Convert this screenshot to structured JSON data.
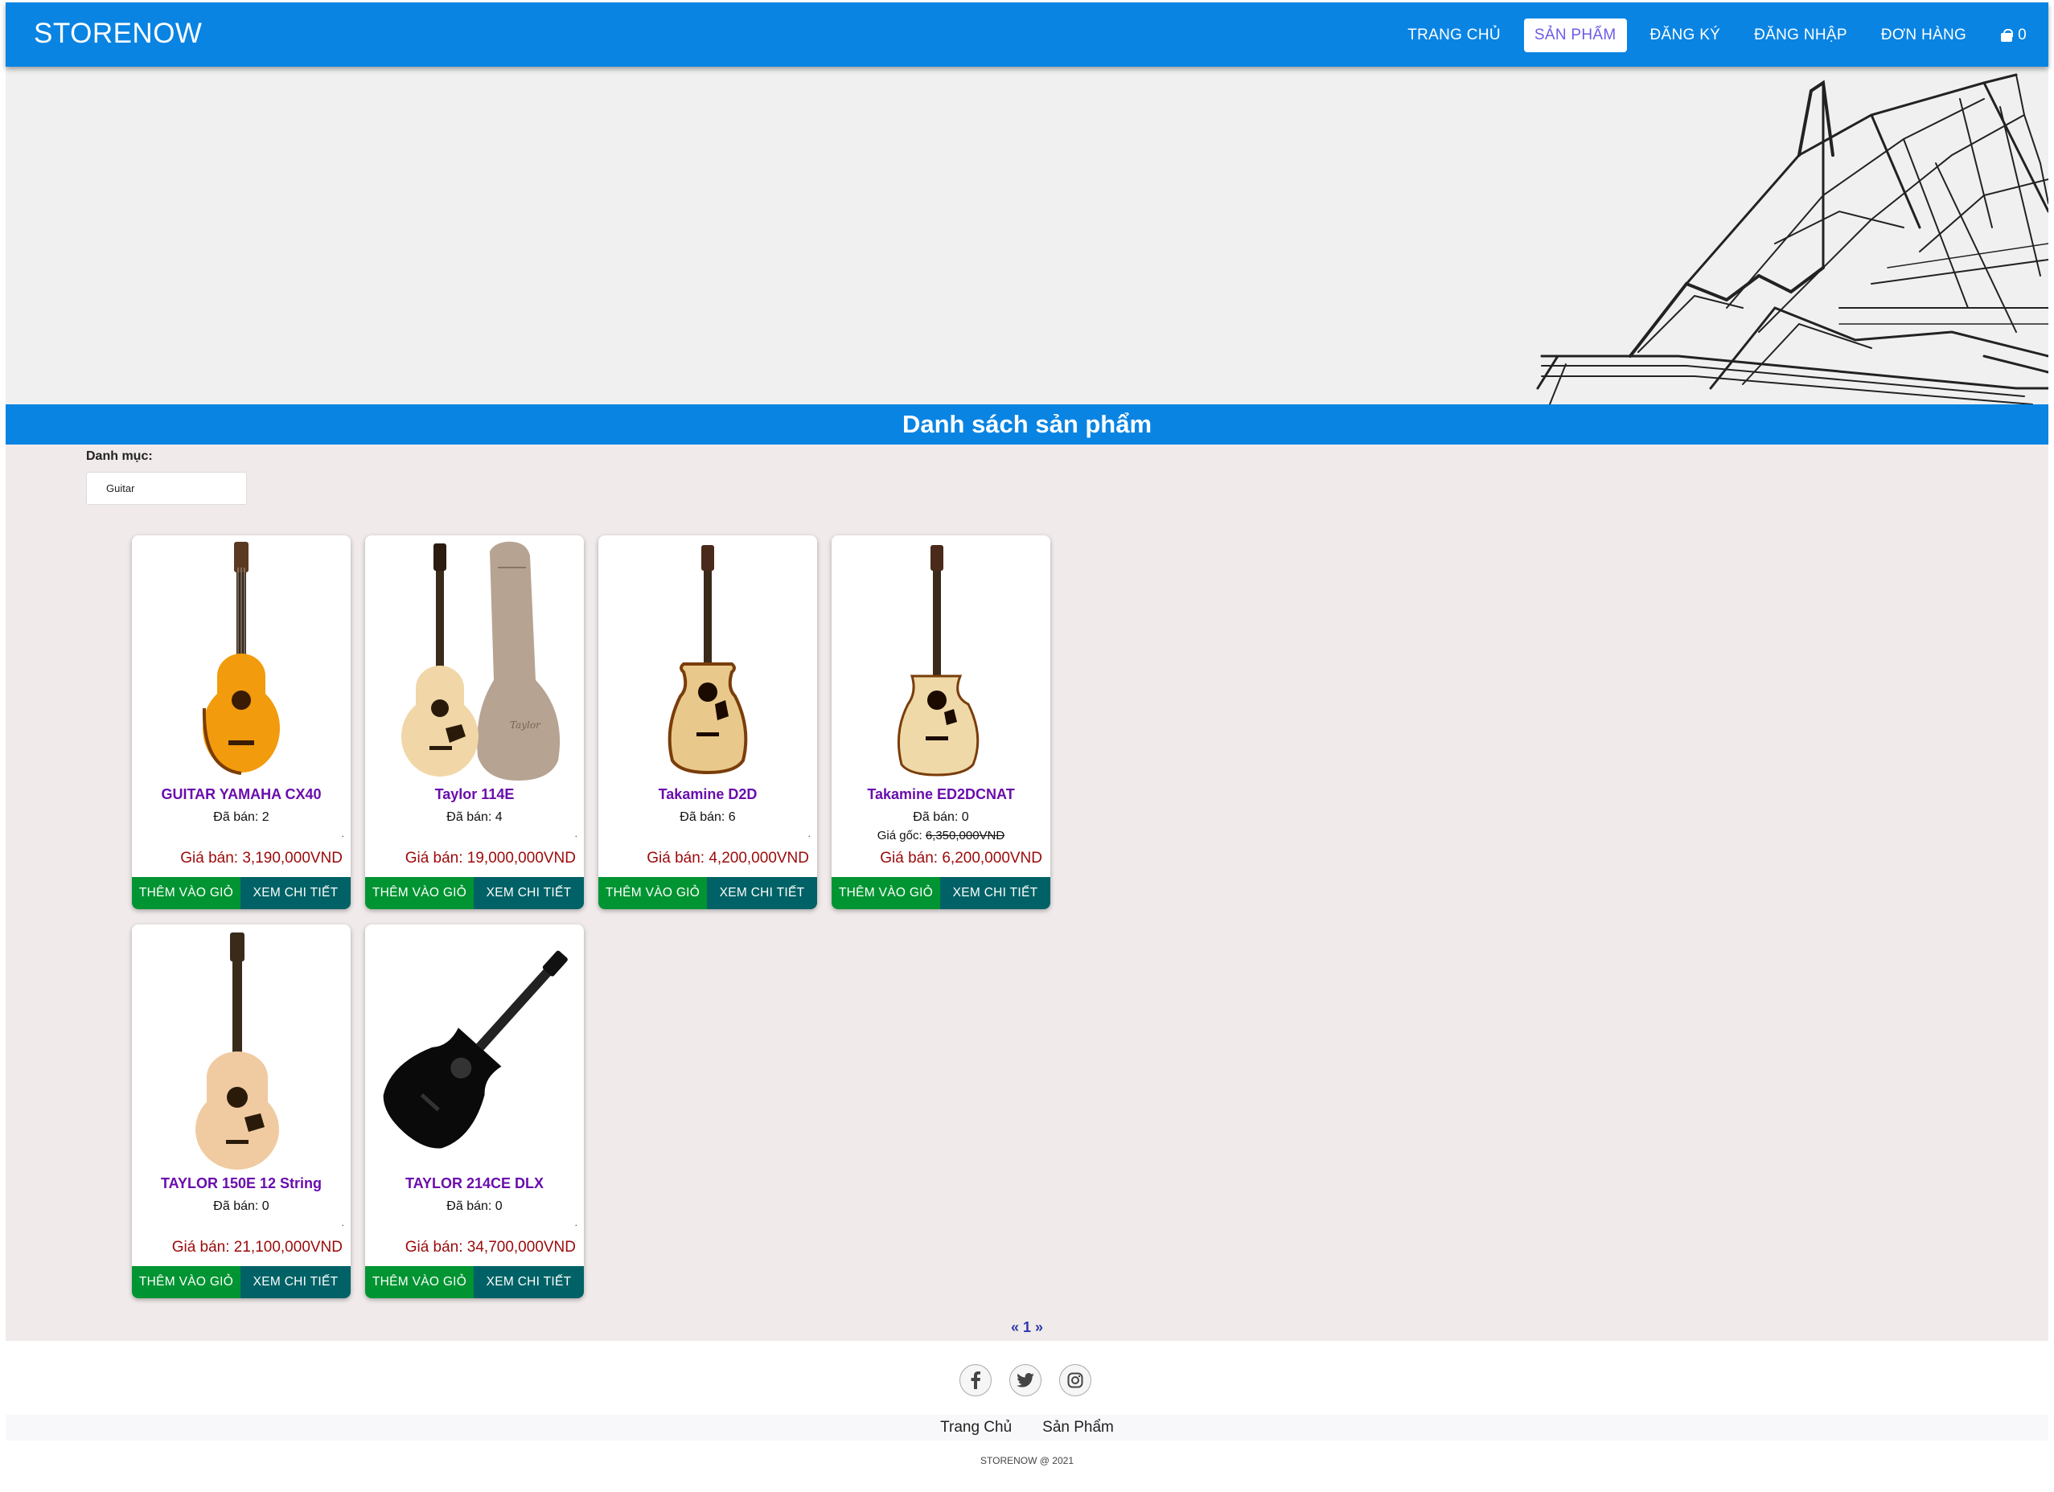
{
  "brand": "STORENOW",
  "nav": {
    "items": [
      "TRANG CHỦ",
      "SẢN PHẨM",
      "ĐĂNG KÝ",
      "ĐĂNG NHẬP",
      "ĐƠN HÀNG"
    ],
    "active": "SẢN PHẨM",
    "cart_count": "0"
  },
  "page_title": "Danh sách sản phẩm",
  "category": {
    "label": "Danh mục:",
    "selected": "Guitar"
  },
  "products": [
    {
      "name": "GUITAR YAMAHA CX40",
      "sold": "Đã bán: 2",
      "original": "",
      "price": "Giá bán: 3,190,000VND",
      "add": "THÊM VÀO GIỎ",
      "view": "XEM CHI TIẾT"
    },
    {
      "name": "Taylor 114E",
      "sold": "Đã bán: 4",
      "original": "",
      "price": "Giá bán: 19,000,000VND",
      "add": "THÊM VÀO GIỎ",
      "view": "XEM CHI TIẾT"
    },
    {
      "name": "Takamine D2D",
      "sold": "Đã bán: 6",
      "original": "",
      "price": "Giá bán: 4,200,000VND",
      "add": "THÊM VÀO GIỎ",
      "view": "XEM CHI TIẾT"
    },
    {
      "name": "Takamine ED2DCNAT",
      "sold": "Đã bán: 0",
      "original_label": "Giá gốc:",
      "original": "6,350,000VND",
      "price": "Giá bán: 6,200,000VND",
      "add": "THÊM VÀO GIỎ",
      "view": "XEM CHI TIẾT"
    },
    {
      "name": "TAYLOR 150E 12 String",
      "sold": "Đã bán: 0",
      "original": "",
      "price": "Giá bán: 21,100,000VND",
      "add": "THÊM VÀO GIỎ",
      "view": "XEM CHI TIẾT"
    },
    {
      "name": "TAYLOR 214CE DLX",
      "sold": "Đã bán: 0",
      "original": "",
      "price": "Giá bán: 34,700,000VND",
      "add": "THÊM VÀO GIỎ",
      "view": "XEM CHI TIẾT"
    }
  ],
  "pagination": "« 1 »",
  "footer": {
    "socials": [
      "facebook-icon",
      "twitter-icon",
      "instagram-icon"
    ],
    "links": [
      "Trang Chủ",
      "Sản Phẩm"
    ],
    "copyright": "STORENOW @ 2021"
  },
  "colors": {
    "primary": "#0984e3",
    "product_name": "#6a0dad",
    "price": "#9b0a0a",
    "add_button": "#009432",
    "view_button": "#006266",
    "background": "#f0eaea"
  }
}
